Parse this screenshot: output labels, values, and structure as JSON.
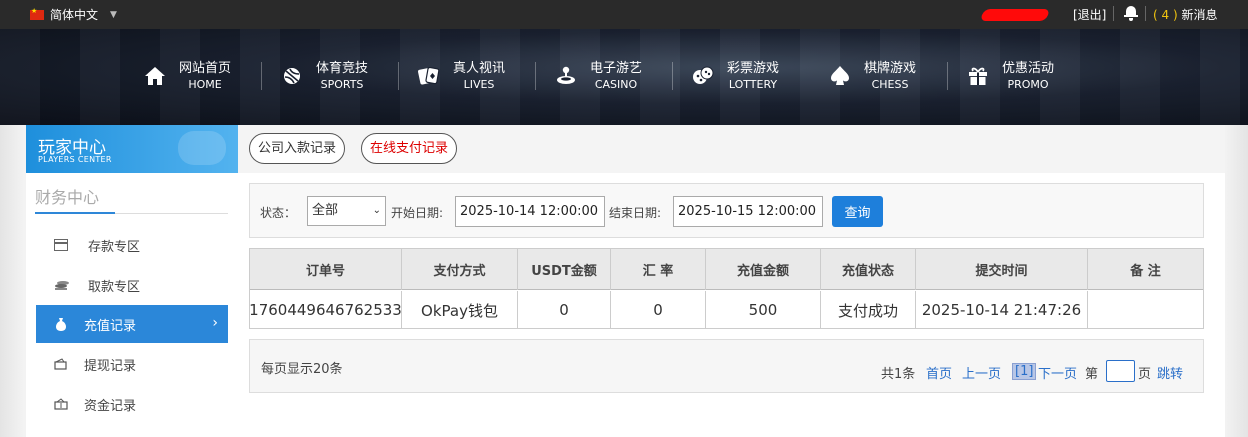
{
  "topbar": {
    "language": "简体中文",
    "logout": "[退出]",
    "message_count": "( 4 )",
    "messages_label": "新消息"
  },
  "nav": [
    {
      "cn": "网站首页",
      "en": "HOME",
      "icon": "home-icon"
    },
    {
      "cn": "体育竞技",
      "en": "SPORTS",
      "icon": "ball-icon"
    },
    {
      "cn": "真人视讯",
      "en": "LIVES",
      "icon": "cards-icon"
    },
    {
      "cn": "电子游艺",
      "en": "CASINO",
      "icon": "joystick-icon"
    },
    {
      "cn": "彩票游戏",
      "en": "LOTTERY",
      "icon": "dice-icon"
    },
    {
      "cn": "棋牌游戏",
      "en": "CHESS",
      "icon": "spade-icon"
    },
    {
      "cn": "优惠活动",
      "en": "PROMO",
      "icon": "gift-icon"
    }
  ],
  "sidebar": {
    "title": "玩家中心",
    "subtitle": "PLAYERS CENTER",
    "section": "财务中心",
    "items": [
      {
        "label": "存款专区",
        "icon": "deposit-icon"
      },
      {
        "label": "取款专区",
        "icon": "withdraw-icon"
      },
      {
        "label": "充值记录",
        "icon": "recharge-icon",
        "active": true
      },
      {
        "label": "提现记录",
        "icon": "withdraw-record-icon"
      },
      {
        "label": "资金记录",
        "icon": "funds-icon"
      }
    ]
  },
  "tabs": [
    {
      "label": "公司入款记录"
    },
    {
      "label": "在线支付记录",
      "active": true
    }
  ],
  "filter": {
    "status_label": "状态：",
    "status_value": "全部",
    "start_label": "开始日期:",
    "start_value": "2025-10-14 12:00:00",
    "end_label": "结束日期:",
    "end_value": "2025-10-15 12:00:00",
    "query_button": "查询"
  },
  "table": {
    "columns": [
      "订单号",
      "支付方式",
      "USDT金额",
      "汇 率",
      "充值金额",
      "充值状态",
      "提交时间",
      "备 注"
    ],
    "rows": [
      [
        "1760449646762533",
        "OkPay钱包",
        "0",
        "0",
        "500",
        "支付成功",
        "2025-10-14 21:47:26",
        ""
      ]
    ]
  },
  "pager": {
    "per_page": "每页显示20条",
    "total": "共1条",
    "first": "首页",
    "prev": "上一页",
    "current": "[1]",
    "next": "下一页",
    "page_prefix": "第",
    "page_suffix": "页",
    "jump": "跳转"
  },
  "colors": {
    "accent": "#2b87d9",
    "active_tab_text": "#dd0000",
    "message_count": "#f1c40f"
  }
}
